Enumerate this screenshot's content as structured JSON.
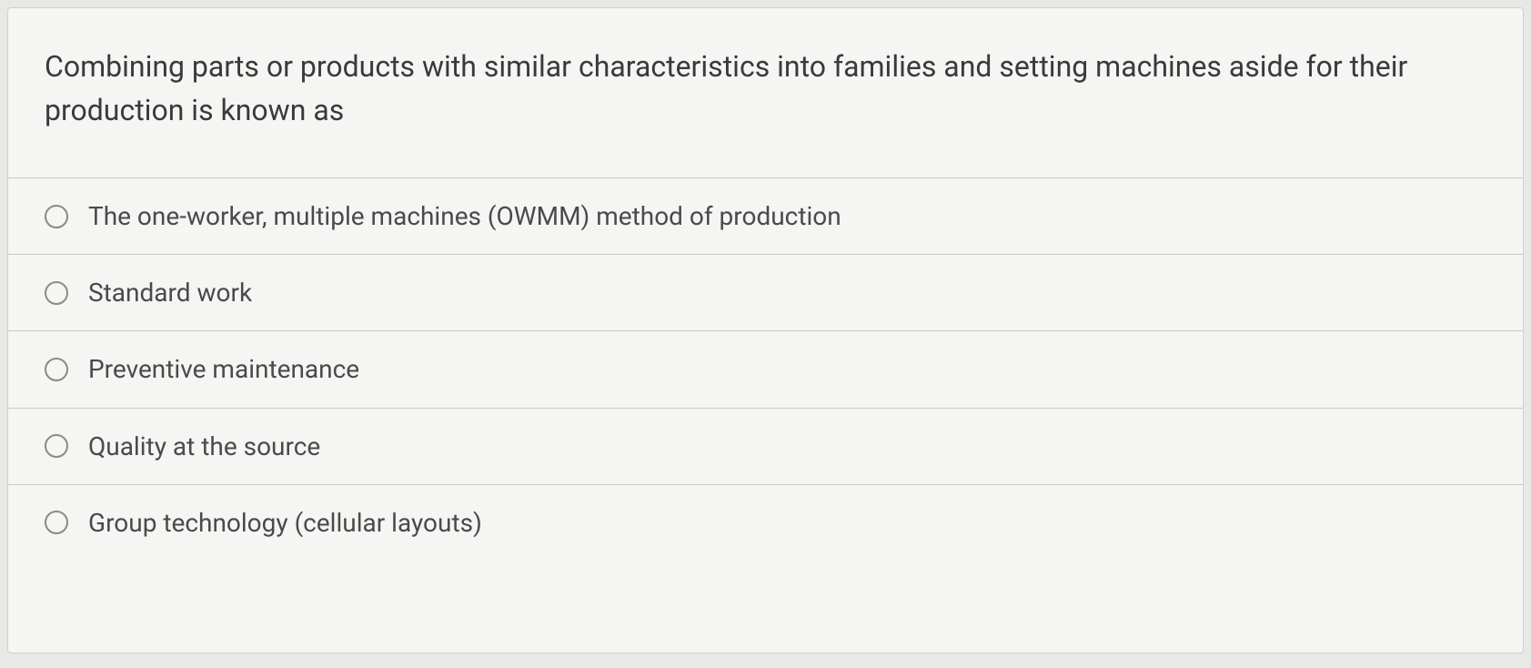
{
  "question": {
    "prompt": "Combining parts or products with similar characteristics into families and setting machines aside for their production is known as",
    "options": [
      {
        "label": "The one-worker, multiple machines (OWMM) method of production"
      },
      {
        "label": "Standard work"
      },
      {
        "label": "Preventive maintenance"
      },
      {
        "label": "Quality at the source"
      },
      {
        "label": "Group technology (cellular layouts)"
      }
    ]
  }
}
